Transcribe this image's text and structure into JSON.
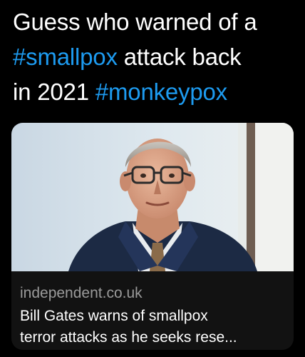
{
  "tweet": {
    "line1": "Guess who warned of a",
    "hashtag_smallpox": "#smallpox",
    "line2_rest": " attack back",
    "line3_start": "in 2021 ",
    "hashtag_monkeypox": "#monkeypox"
  },
  "link_card": {
    "image_alt": "Photo of Bill Gates",
    "domain": "independent.co.uk",
    "title_line1": "Bill Gates warns of smallpox",
    "title_line2": "terror attacks as he seeks rese..."
  },
  "colors": {
    "background": "#000000",
    "text": "#ffffff",
    "hashtag": "#1d9bf0",
    "card_info_background": "#121212",
    "domain_text": "#9a9a9a"
  }
}
